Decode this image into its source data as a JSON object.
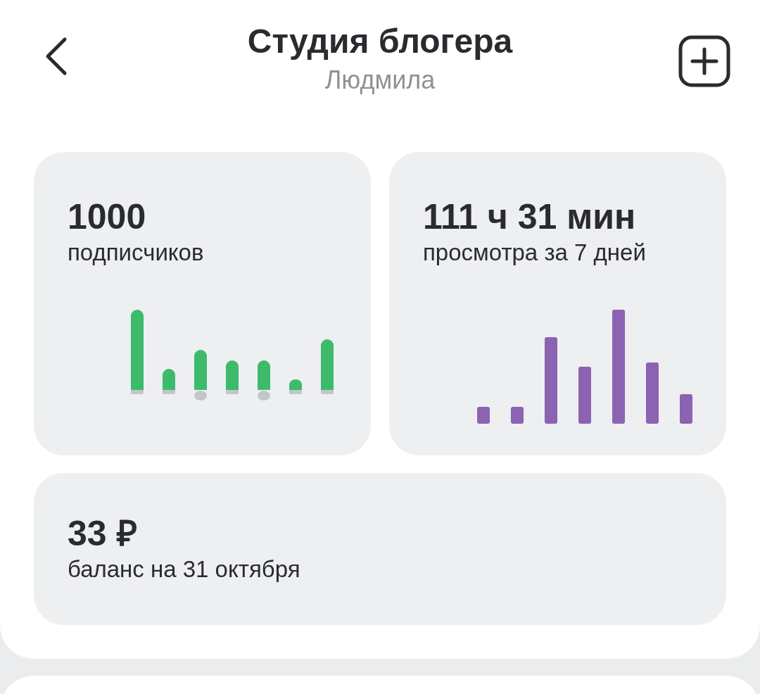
{
  "header": {
    "title": "Студия блогера",
    "subtitle": "Людмила"
  },
  "stats": [
    {
      "kind": "subscribers",
      "value": "1000",
      "label": "подписчиков"
    },
    {
      "kind": "views",
      "value": "111 ч 31 мин",
      "label": "просмотра за 7 дней"
    }
  ],
  "balance": {
    "value": "33 ₽",
    "label": "баланс на 31 октября"
  }
}
